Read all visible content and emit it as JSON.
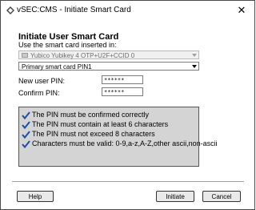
{
  "window": {
    "title": "vSEC:CMS - Initiate Smart Card",
    "close_glyph": "✕"
  },
  "header": {
    "heading": "Initiate User Smart Card",
    "sublabel": "Use the smart card inserted in:"
  },
  "reader_select": {
    "value": "Yubico Yubikey 4 OTP+U2F+CCID 0",
    "icon": "smart-card-icon",
    "disabled": true
  },
  "pin_select": {
    "value": "Primary smart card PIN1"
  },
  "form": {
    "new_pin_label": "New user PIN:",
    "new_pin_value": "******",
    "confirm_pin_label": "Confirm PIN:",
    "confirm_pin_value": "******"
  },
  "rules": [
    "The PIN must be confirmed correctly",
    "The PIN must contain at least 6 characters",
    "The PIN must not exceed 8 characters",
    "Characters must be valid: 0-9,a-z,A-Z,other ascii,non-ascii"
  ],
  "buttons": {
    "help": "Help",
    "initiate": "Initiate",
    "cancel": "Cancel"
  },
  "colors": {
    "check": "#1f4e9c",
    "rules_bg": "#d4d4d4"
  }
}
